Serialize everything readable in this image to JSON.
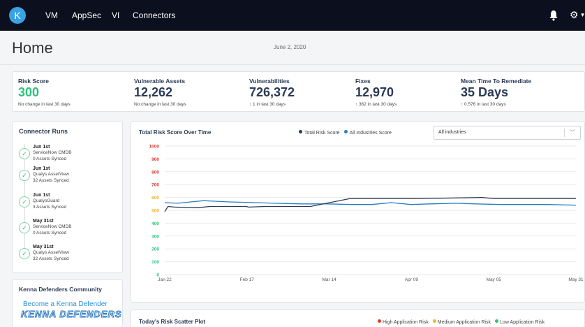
{
  "nav": {
    "logo_letter": "K",
    "items": [
      "VM",
      "AppSec",
      "VI",
      "Connectors"
    ]
  },
  "header": {
    "title": "Home",
    "date": "June 2, 2020"
  },
  "metrics": [
    {
      "label": "Risk Score",
      "value": "300",
      "sub": "No change in last 30 days",
      "value_color": "#2ec27e"
    },
    {
      "label": "Vulnerable Assets",
      "value": "12,262",
      "sub": "No change in last 30 days"
    },
    {
      "label": "Vulnerabilities",
      "value": "726,372",
      "sub": "↑ 1 in last 30 days"
    },
    {
      "label": "Fixes",
      "value": "12,970",
      "sub": "↑ 362 in last 30 days"
    },
    {
      "label": "Mean Time To Remediate",
      "value": "35 Days",
      "sub": "↑ 0.576 in last 30 days"
    }
  ],
  "connector_runs": {
    "title": "Connector Runs",
    "runs": [
      {
        "date": "Jun 1st",
        "name": "ServiceNow CMDB",
        "assets": "0 Assets Synced"
      },
      {
        "date": "Jun 1st",
        "name": "Qualys AssetView",
        "assets": "32 Assets Synced"
      },
      {
        "date": "Jun 1st",
        "name": "QualysGuard",
        "assets": "3 Assets Synced"
      },
      {
        "date": "May 31st",
        "name": "ServiceNow CMDB",
        "assets": "0 Assets Synced"
      },
      {
        "date": "May 31st",
        "name": "Qualys AssetView",
        "assets": "32 Assets Synced"
      }
    ]
  },
  "community": {
    "title": "Kenna Defenders Community",
    "link": "Become a Kenna Defender",
    "logo_text": "KENNA DEFENDERS"
  },
  "chart_card": {
    "title": "Total Risk Score Over Time",
    "legend": [
      "Total Risk Score",
      "All Industries Score"
    ],
    "select_value": "All industries"
  },
  "chart_data": {
    "type": "line",
    "x_ticks": [
      "Jan 22",
      "Feb 17",
      "Mar 14",
      "Apr 09",
      "May 05",
      "May 31"
    ],
    "y_ticks": [
      0,
      100,
      200,
      300,
      400,
      500,
      600,
      700,
      800,
      900,
      1000
    ],
    "y_tick_colors": [
      "#2ec27e",
      "#2ec27e",
      "#2ec27e",
      "#2ec27e",
      "#2ec27e",
      "#f0b429",
      "#f0b429",
      "#e03a2f",
      "#e03a2f",
      "#e03a2f",
      "#e03a2f"
    ],
    "ylim": [
      0,
      1000
    ],
    "grid": true,
    "legend_position": "top-center",
    "series": [
      {
        "name": "Total Risk Score",
        "color": "#2b3a55",
        "x": [
          0,
          1,
          3,
          10,
          14,
          18,
          25,
          26,
          31,
          38,
          45,
          57,
          77,
          98,
          102,
          127
        ],
        "values": [
          490,
          530,
          525,
          520,
          530,
          530,
          530,
          525,
          530,
          530,
          530,
          590,
          590,
          600,
          590,
          590
        ]
      },
      {
        "name": "All Industries Score",
        "color": "#2a7dc0",
        "x": [
          0,
          4,
          8,
          12,
          16,
          20,
          28,
          34,
          42,
          50,
          58,
          64,
          70,
          76,
          82,
          90,
          96,
          104,
          110,
          118,
          127
        ],
        "values": [
          560,
          555,
          565,
          575,
          570,
          565,
          560,
          555,
          550,
          550,
          545,
          545,
          560,
          545,
          550,
          555,
          550,
          545,
          545,
          545,
          540
        ]
      }
    ]
  },
  "scatter_card": {
    "title": "Today's Risk Scatter Plot",
    "legend": [
      {
        "label": "High Application Risk",
        "color": "#e03a2f"
      },
      {
        "label": "Medium Application Risk",
        "color": "#f0b429"
      },
      {
        "label": "Low Application Risk",
        "color": "#2ec27e"
      }
    ]
  },
  "icons": {
    "bell": "bell-icon",
    "gear": "gear-icon"
  }
}
